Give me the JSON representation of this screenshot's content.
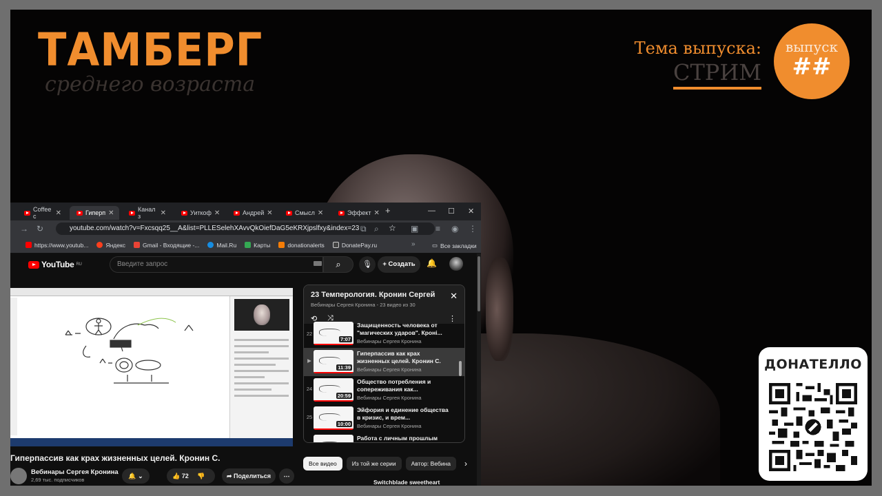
{
  "overlay": {
    "logo_main": "ТАМБЕРГ",
    "logo_sub": "среднего возраста",
    "topic_label": "Тема выпуска:",
    "topic_value": "СТРИМ",
    "episode_label": "выпуск",
    "episode_number": "##",
    "donate_title": "ДОНАТЕЛЛО",
    "accent_color": "#f08d2e"
  },
  "browser": {
    "tabs": [
      {
        "label": "Coffee с"
      },
      {
        "label": "Гиперп"
      },
      {
        "label": "Канал з"
      },
      {
        "label": "Уиткоф"
      },
      {
        "label": "Андрей"
      },
      {
        "label": "Смысл"
      },
      {
        "label": "Эффект"
      }
    ],
    "url": "youtube.com/watch?v=Fxcsqq25__A&list=PLLESelehXAvvQkOiefDaG5eKRXjpslfxy&index=23",
    "bookmarks": [
      {
        "label": "https://www.youtub...",
        "icon": "youtube-icon"
      },
      {
        "label": "Яндекс",
        "icon": "yandex-icon"
      },
      {
        "label": "Gmail - Входящие -...",
        "icon": "gmail-icon"
      },
      {
        "label": "Mail.Ru",
        "icon": "mailru-icon"
      },
      {
        "label": "Карты",
        "icon": "maps-icon"
      },
      {
        "label": "donationalerts",
        "icon": "donationalerts-icon"
      },
      {
        "label": "DonatePay.ru",
        "icon": "donatepay-icon"
      }
    ],
    "all_bookmarks": "Все закладки"
  },
  "youtube": {
    "logo": "YouTube",
    "logo_region": "RU",
    "search_placeholder": "Введите запрос",
    "create_label": "Создать",
    "video_title": "Гиперпассив как крах жизненных целей. Кронин С.",
    "channel_name": "Вебинары Сергея Кронина",
    "subscribers": "2,69 тыс. подписчиков",
    "likes": "72",
    "share_label": "Поделиться",
    "playlist": {
      "title": "23 Темперология. Кронин Сергей",
      "channel": "Вебинары Сергея Кронина",
      "position": "23 видео из 30",
      "items": [
        {
          "index": "22",
          "title": "Защищенность человека от \"магических ударов\". Кроні...",
          "channel": "Вебинары Сергея Кронина",
          "duration": "7:07",
          "current": false
        },
        {
          "index": "▶",
          "title": "Гиперпассив как крах жизненных целей. Кронин С.",
          "channel": "Вебинары Сергея Кронина",
          "duration": "11:39",
          "current": true
        },
        {
          "index": "24",
          "title": "Общество потребления и сопереживания как...",
          "channel": "Вебинары Сергея Кронина",
          "duration": "20:59",
          "current": false
        },
        {
          "index": "25",
          "title": "Эйфория и единение общества в кризис, и врем...",
          "channel": "Вебинары Сергея Кронина",
          "duration": "10:00",
          "current": false
        },
        {
          "index": "",
          "title": "Работа с личным прошлым",
          "channel": "",
          "duration": "",
          "current": false
        }
      ]
    },
    "chips": [
      "Все видео",
      "Из той же серии",
      "Автор: Вебина"
    ],
    "next_video_title": "Switchblade sweetheart"
  }
}
